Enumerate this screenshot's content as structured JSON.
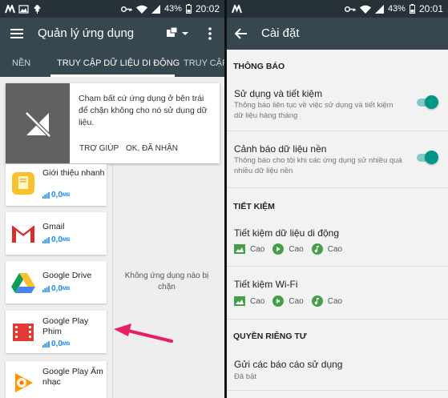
{
  "left": {
    "status": {
      "battery": "43%",
      "time": "20:02"
    },
    "appbar": {
      "title": "Quản lý ứng dụng"
    },
    "tabs": [
      {
        "label": "NỀN"
      },
      {
        "label": "TRUY CẬP DỮ LIỆU DI ĐỘNG"
      },
      {
        "label": "TRUY CẬP"
      }
    ],
    "dialog": {
      "message": "Chạm bất cứ ứng dụng ở bên trái để chặn không cho nó sử dụng dữ liệu.",
      "help": "TRỢ GIÚP",
      "ok": "OK, ĐÃ NHẬN"
    },
    "apps": [
      {
        "name": "Giới thiệu nhanh",
        "data": "0,0",
        "unit": "MB"
      },
      {
        "name": "Gmail",
        "data": "0,0",
        "unit": "MB"
      },
      {
        "name": "Google Drive",
        "data": "0,0",
        "unit": "MB"
      },
      {
        "name": "Google Play Phim",
        "data": "0,0",
        "unit": "MB"
      },
      {
        "name": "Google Play Âm nhạc",
        "data": "0,0",
        "unit": "MB"
      }
    ],
    "empty_message": "Không ứng dụng nào bị chặn"
  },
  "right": {
    "status": {
      "battery": "43%",
      "time": "20:01"
    },
    "appbar": {
      "title": "Cài đặt"
    },
    "sections": {
      "notifications": "THÔNG BÁO",
      "saving": "TIẾT KIỆM",
      "privacy": "QUYỀN RIÊNG TƯ"
    },
    "settings": {
      "usage": {
        "title": "Sử dụng và tiết kiệm",
        "subtitle": "Thông báo liên tục về việc sử dụng và tiết kiệm dữ liệu hàng tháng",
        "enabled": true
      },
      "bg_warning": {
        "title": "Cảnh báo dữ liệu nền",
        "subtitle": "Thông báo cho tôi khi các ứng dụng sử nhiều quá nhiều dữ liệu nền",
        "enabled": true
      },
      "mobile_saving": {
        "title": "Tiết kiệm dữ liệu di động",
        "levels": [
          "Cao",
          "Cao",
          "Cao"
        ]
      },
      "wifi_saving": {
        "title": "Tiết kiệm Wi-Fi",
        "levels": [
          "Cao",
          "Cao",
          "Cao"
        ]
      },
      "reports": {
        "title": "Gửi các báo cáo sử dụng",
        "subtitle": "Đã bật"
      }
    }
  },
  "colors": {
    "toolbar": "#37474f",
    "statusbar": "#263238",
    "accent": "#009688",
    "arrow": "#e91e63",
    "data_blue": "#1e88e5"
  }
}
